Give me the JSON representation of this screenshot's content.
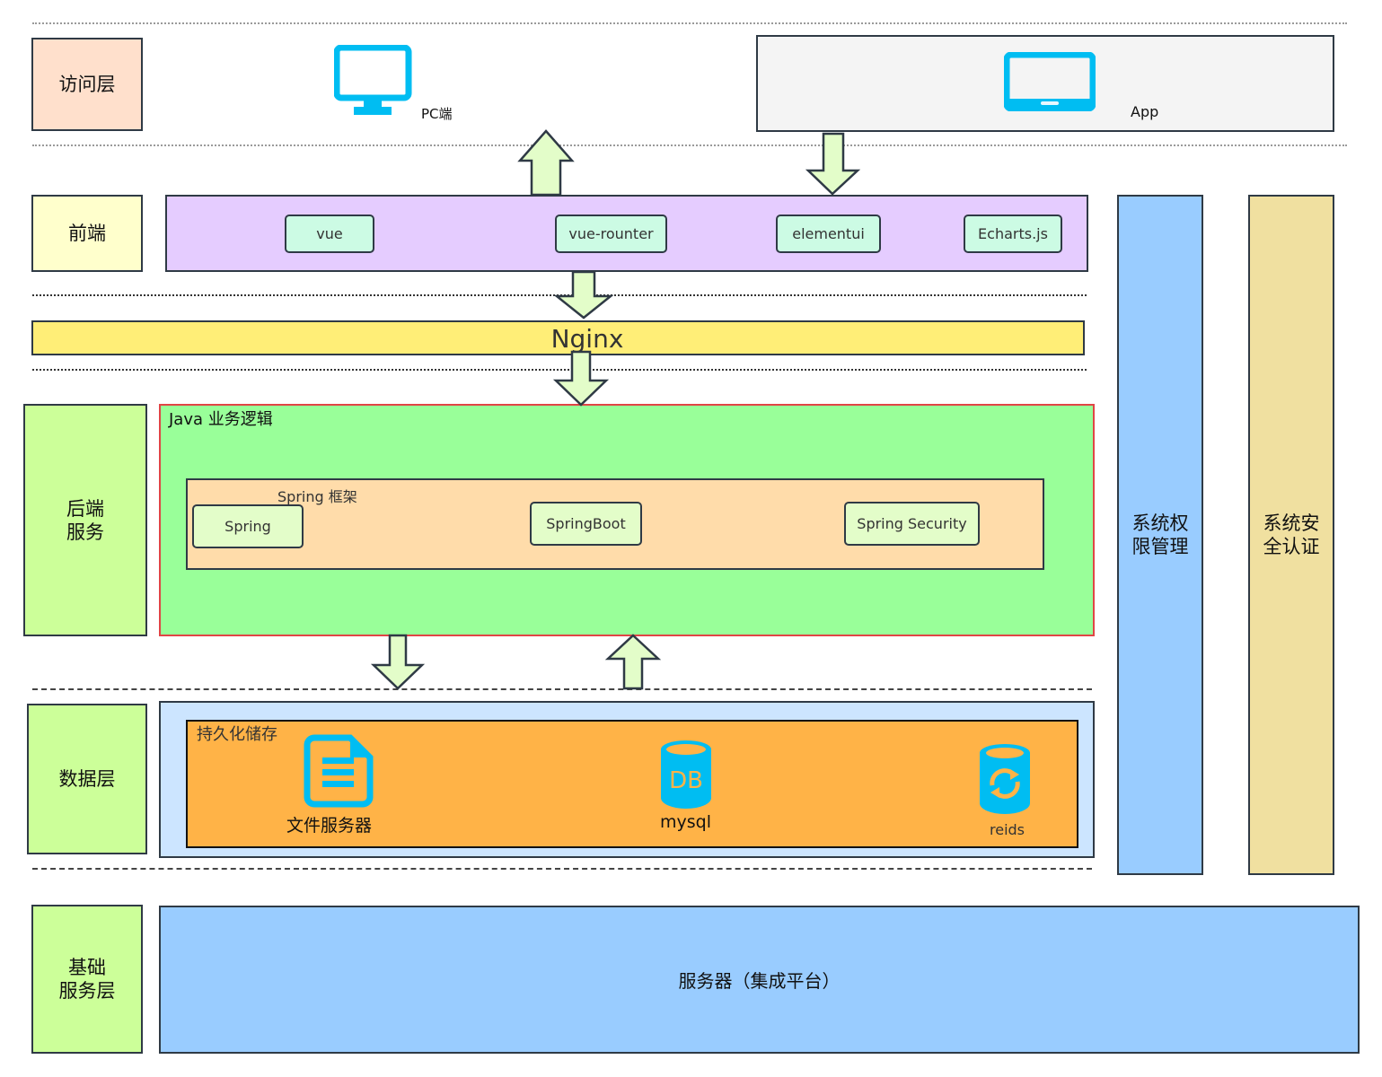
{
  "layers": {
    "access": "访问层",
    "frontend": "前端",
    "backend": "后端\n服务",
    "data": "数据层",
    "infra": "基础\n服务层"
  },
  "access": {
    "pc": {
      "label": "PC端",
      "icon": "monitor-icon"
    },
    "app": {
      "label": "App",
      "icon": "tablet-icon"
    }
  },
  "frontend": {
    "items": [
      "vue",
      "vue-rounter",
      "elementui",
      "Echarts.js"
    ]
  },
  "nginx": {
    "label": "Nginx"
  },
  "backend": {
    "title": "Java 业务逻辑",
    "framework_title": "Spring 框架",
    "items": [
      "Spring",
      "SpringBoot",
      "Spring Security"
    ]
  },
  "data": {
    "title": "持久化储存",
    "items": [
      {
        "label": "文件服务器",
        "icon": "document-icon"
      },
      {
        "label": "mysql",
        "icon": "database-icon",
        "icon_text": "DB"
      },
      {
        "label": "reids",
        "icon": "database-sync-icon"
      }
    ]
  },
  "infra": {
    "label": "服务器（集成平台）"
  },
  "side": {
    "permission": "系统权\n限管理",
    "security": "系统安\n全认证"
  },
  "colors": {
    "icon_blue": "#00bdf2",
    "access_label": "#ffe0cc",
    "frontend_label": "#ffffcc",
    "green_label": "#ccff99",
    "frontend_band": "#e5ccff",
    "chip": "#ccffe6",
    "nginx": "#ffee77",
    "java": "#99ff99",
    "spring": "#ffdcaa",
    "data_outer": "#cce5ff",
    "data_inner": "#ffb347",
    "infra": "#99ccff",
    "permission": "#99ccff",
    "security": "#f0e0a0",
    "arrow_fill": "#e3fdc9"
  }
}
